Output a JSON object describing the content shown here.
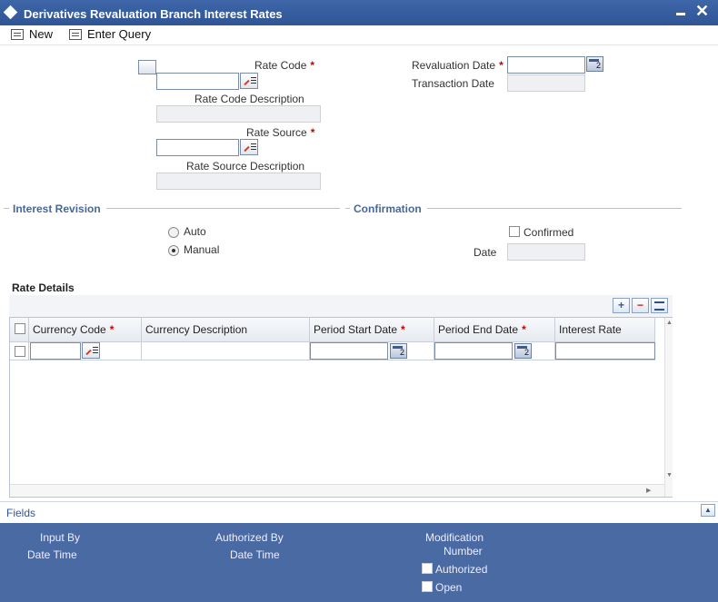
{
  "window": {
    "title": "Derivatives Revaluation Branch Interest Rates"
  },
  "toolbar": {
    "new_label": "New",
    "enter_query_label": "Enter Query"
  },
  "form": {
    "rate_code_label": "Rate Code",
    "rate_code_value": "",
    "rate_code_desc_label": "Rate Code Description",
    "rate_source_label": "Rate Source",
    "rate_source_value": "",
    "rate_source_desc_label": "Rate Source Description",
    "revaluation_date_label": "Revaluation Date",
    "transaction_date_label": "Transaction Date",
    "required_marker": "*"
  },
  "interest_revision": {
    "title": "Interest Revision",
    "options": [
      "Auto",
      "Manual"
    ],
    "selected": "Manual"
  },
  "confirmation": {
    "title": "Confirmation",
    "confirmed_label": "Confirmed",
    "date_label": "Date"
  },
  "rate_details": {
    "title": "Rate Details",
    "add_icon": "+",
    "remove_icon": "−",
    "columns": [
      "Currency Code",
      "Currency Description",
      "Period Start Date",
      "Period End Date",
      "Interest Rate"
    ]
  },
  "fields_bar": {
    "label": "Fields"
  },
  "audit": {
    "input_by": "Input By",
    "date_time_1": "Date Time",
    "authorized_by": "Authorized By",
    "date_time_2": "Date Time",
    "modification": "Modification",
    "number": "Number",
    "authorized_label": "Authorized",
    "open_label": "Open"
  },
  "colors": {
    "title_bar": "#2f5595",
    "footer": "#4a6aa3",
    "section_title": "#4a6795",
    "required": "#cc0000"
  }
}
